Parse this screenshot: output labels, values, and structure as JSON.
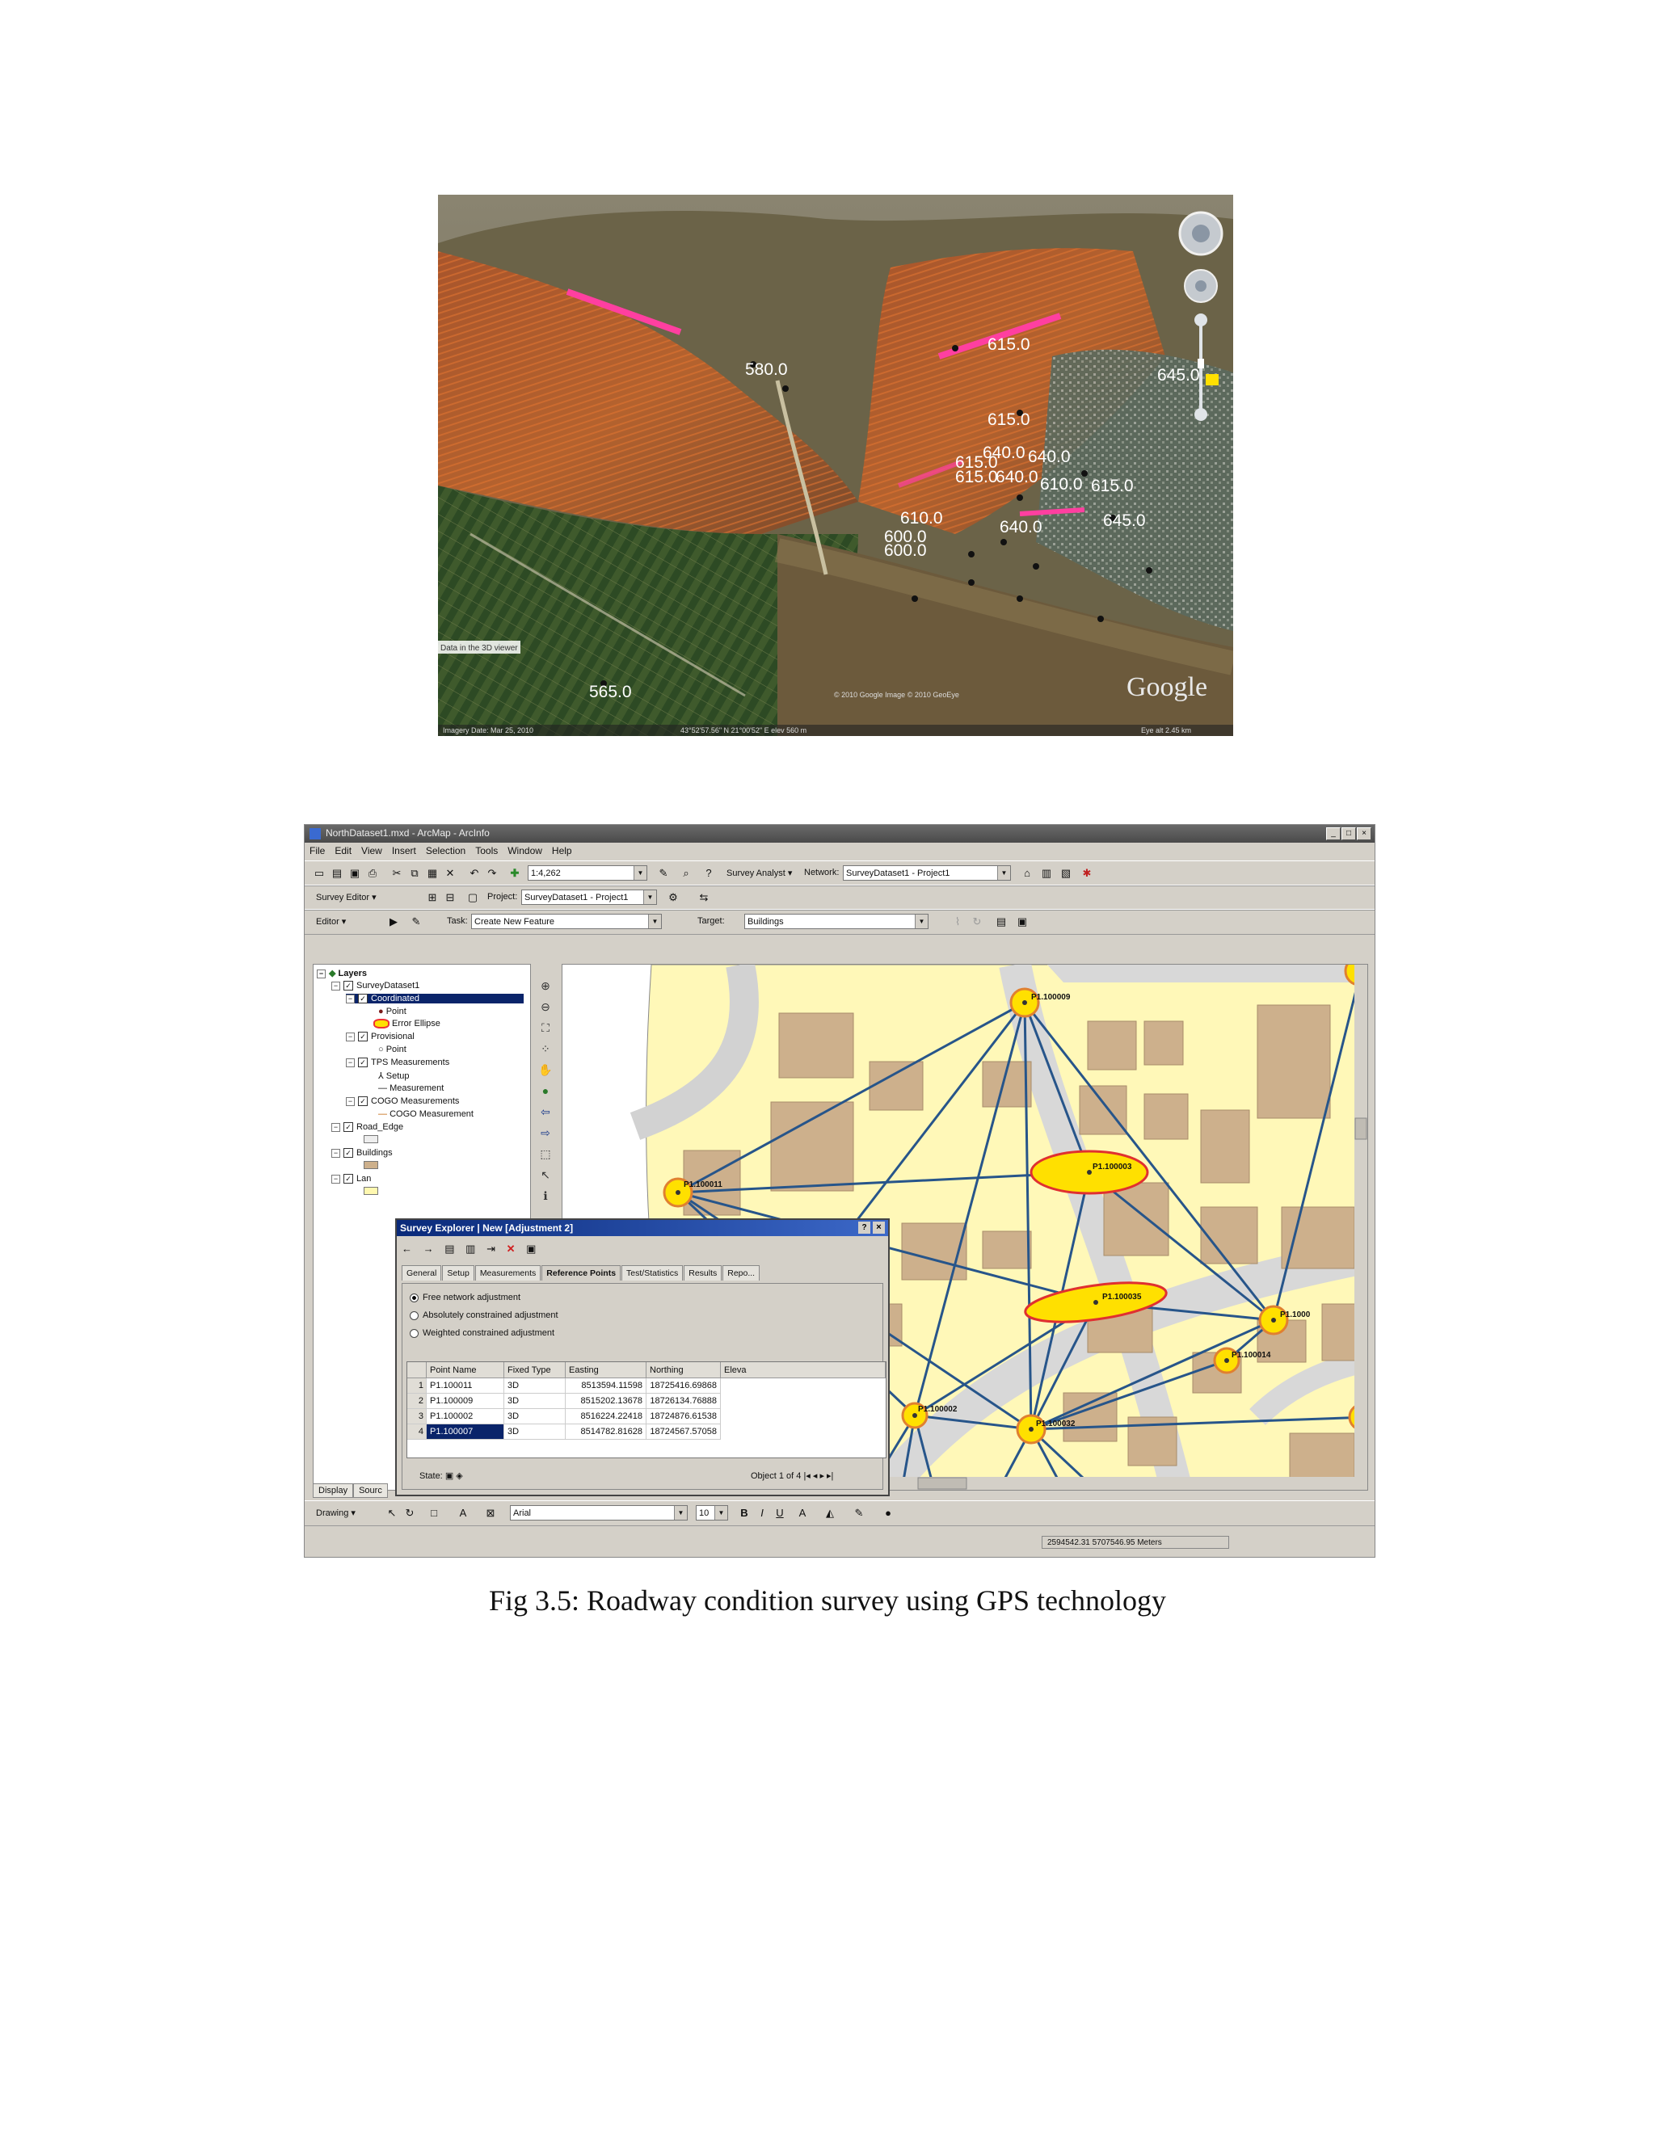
{
  "caption": "Fig 3.5: Roadway condition survey using GPS technology",
  "google_earth": {
    "elevation_labels": [
      "580.0",
      "615.0",
      "645.0",
      "615.0",
      "640.0",
      "640.0",
      "615.0",
      "615.0",
      "640.0",
      "610.0",
      "615.0",
      "645.0",
      "610.0",
      "640.0",
      "600.0",
      "600.0",
      "565.0"
    ],
    "logo": "Google",
    "imagery_date": "Imagery Date: Mar 25, 2010",
    "status_coords": "43°52'57.56\" N   21°00'52\" E  elev 560 m",
    "tooltip": "Data in the 3D viewer",
    "credits": "© 2010 Google\nImage © 2010 GeoEye",
    "eye_alt": "Eye alt 2.45 km"
  },
  "arcmap": {
    "title": "NorthDataset1.mxd - ArcMap - ArcInfo",
    "menu": [
      "File",
      "Edit",
      "View",
      "Insert",
      "Selection",
      "Tools",
      "Window",
      "Help"
    ],
    "scale": "1:4,262",
    "survey_analyst_label": "Survey Analyst ▾",
    "network_label": "Network:",
    "network_value": "SurveyDataset1 - Project1",
    "survey_editor_label": "Survey Editor ▾",
    "project_label": "Project:",
    "project_value": "SurveyDataset1 - Project1",
    "editor_label": "Editor ▾",
    "task_label": "Task:",
    "task_value": "Create New Feature",
    "target_label": "Target:",
    "target_value": "Buildings",
    "toc": {
      "root": "Layers",
      "dataset": "SurveyDataset1",
      "coordinated": "Coordinated",
      "point": "Point",
      "error_ellipse": "Error Ellipse",
      "provisional": "Provisional",
      "point2": "Point",
      "tps": "TPS Measurements",
      "setup": "Setup",
      "measurement": "Measurement",
      "cogo": "COGO Measurements",
      "cogo_measurement": "COGO Measurement",
      "road_edge": "Road_Edge",
      "buildings": "Buildings",
      "last": "Lan",
      "tab_display": "Display",
      "tab_source": "Sourc"
    },
    "map_labels": [
      "P1.100009",
      "P1.100011",
      "P1.100003",
      "P1.100035",
      "P1.100014",
      "P1.100002",
      "P1.100032",
      "P1.1000"
    ],
    "drawing_label": "Drawing ▾",
    "font_value": "Arial",
    "font_size": "10",
    "status_coords": "2594542.31  5707546.95 Meters",
    "survey_explorer": {
      "title": "Survey Explorer | New [Adjustment 2]",
      "tabs": [
        "General",
        "Setup",
        "Measurements",
        "Reference Points",
        "Test/Statistics",
        "Results",
        "Repo..."
      ],
      "options": [
        "Free network adjustment",
        "Absolutely constrained adjustment",
        "Weighted constrained adjustment"
      ],
      "columns": [
        "Point Name",
        "Fixed Type",
        "Easting",
        "Northing",
        "Eleva"
      ],
      "rows": [
        {
          "n": "1",
          "name": "P1.100011",
          "fixed": "3D",
          "easting": "8513594.11598",
          "northing": "18725416.69868"
        },
        {
          "n": "2",
          "name": "P1.100009",
          "fixed": "3D",
          "easting": "8515202.13678",
          "northing": "18726134.76888"
        },
        {
          "n": "3",
          "name": "P1.100002",
          "fixed": "3D",
          "easting": "8516224.22418",
          "northing": "18724876.61538"
        },
        {
          "n": "4",
          "name": "P1.100007",
          "fixed": "3D",
          "easting": "8514782.81628",
          "northing": "18724567.57058"
        }
      ],
      "state_label": "State:",
      "object_label": "Object 1 of 4"
    }
  }
}
